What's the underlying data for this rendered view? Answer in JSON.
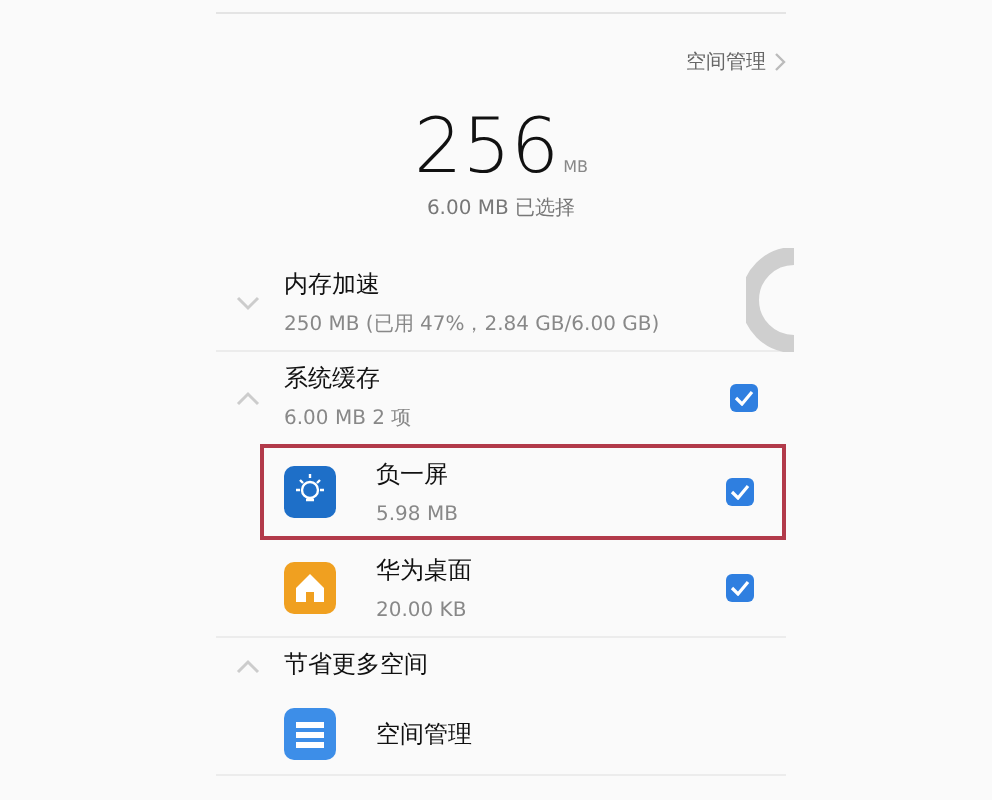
{
  "header_link": {
    "label": "空间管理"
  },
  "total": {
    "value": "256",
    "unit": "MB",
    "selected_text": "6.00 MB 已选择"
  },
  "sections": [
    {
      "title": "内存加速",
      "subtitle": "250 MB (已用 47%，2.84 GB/6.00 GB)",
      "expanded": false
    },
    {
      "title": "系统缓存",
      "subtitle": "6.00 MB  2 项",
      "expanded": true,
      "checked": true,
      "items": [
        {
          "name": "负一屏",
          "size": "5.98 MB",
          "kind": "bulb",
          "checked": true,
          "highlighted": true
        },
        {
          "name": "华为桌面",
          "size": "20.00 KB",
          "kind": "home",
          "checked": true,
          "highlighted": false
        }
      ]
    },
    {
      "title": "节省更多空间",
      "expanded": true,
      "items": [
        {
          "name": "空间管理",
          "kind": "storage",
          "highlighted": false
        }
      ]
    }
  ]
}
